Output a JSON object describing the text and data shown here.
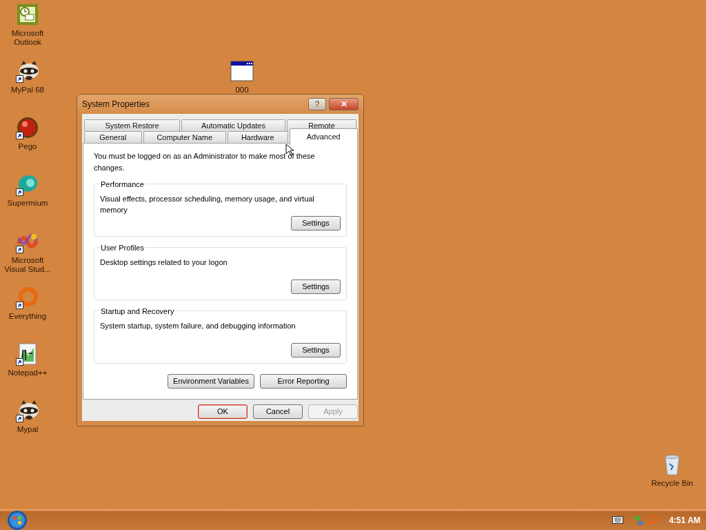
{
  "desktop_icons": [
    {
      "label": "Microsoft Outlook",
      "kind": "clockmail",
      "shortcut": false
    },
    {
      "label": "MyPal 68",
      "kind": "raccoon",
      "shortcut": true
    },
    {
      "label": "Pego",
      "kind": "ball",
      "shortcut": true
    },
    {
      "label": "Supermium",
      "kind": "blob",
      "shortcut": true
    },
    {
      "label": "Microsoft Visual Stud...",
      "kind": "infinity",
      "shortcut": true
    },
    {
      "label": "Everything",
      "kind": "ring",
      "shortcut": true
    },
    {
      "label": "Notepad++",
      "kind": "notepad",
      "shortcut": true
    },
    {
      "label": "Mypal",
      "kind": "raccoon",
      "shortcut": true
    },
    {
      "label": "000",
      "kind": "window",
      "shortcut": false
    },
    {
      "label": "Recycle Bin",
      "kind": "bin",
      "shortcut": false
    }
  ],
  "window": {
    "title": "System Properties",
    "title_buttons": [
      {
        "label": "?",
        "kind": "help"
      },
      {
        "label": "✕",
        "kind": "close"
      }
    ],
    "tab_rows": [
      [
        {
          "label": "System Restore",
          "selected": false
        },
        {
          "label": "Automatic Updates",
          "selected": false
        },
        {
          "label": "Remote",
          "selected": false
        }
      ],
      [
        {
          "label": "General",
          "selected": false
        },
        {
          "label": "Computer Name",
          "selected": false
        },
        {
          "label": "Hardware",
          "selected": false
        },
        {
          "label": "Advanced",
          "selected": true
        }
      ]
    ],
    "notice": "You must be logged on as an Administrator to make most of these changes.",
    "groups": [
      {
        "title": "Performance",
        "description": "Visual effects, processor scheduling, memory usage, and virtual memory",
        "button": "Settings"
      },
      {
        "title": "User Profiles",
        "description": "Desktop settings related to your logon",
        "button": "Settings"
      },
      {
        "title": "Startup and Recovery",
        "description": "System startup, system failure, and debugging information",
        "button": "Settings"
      }
    ],
    "extra_buttons": [
      "Environment Variables",
      "Error Reporting"
    ],
    "footer_buttons": [
      {
        "label": "OK",
        "default": true,
        "disabled": false
      },
      {
        "label": "Cancel",
        "default": false,
        "disabled": false
      },
      {
        "label": "Apply",
        "default": false,
        "disabled": true
      }
    ]
  },
  "taskbar": {
    "clock": "4:51 AM"
  }
}
